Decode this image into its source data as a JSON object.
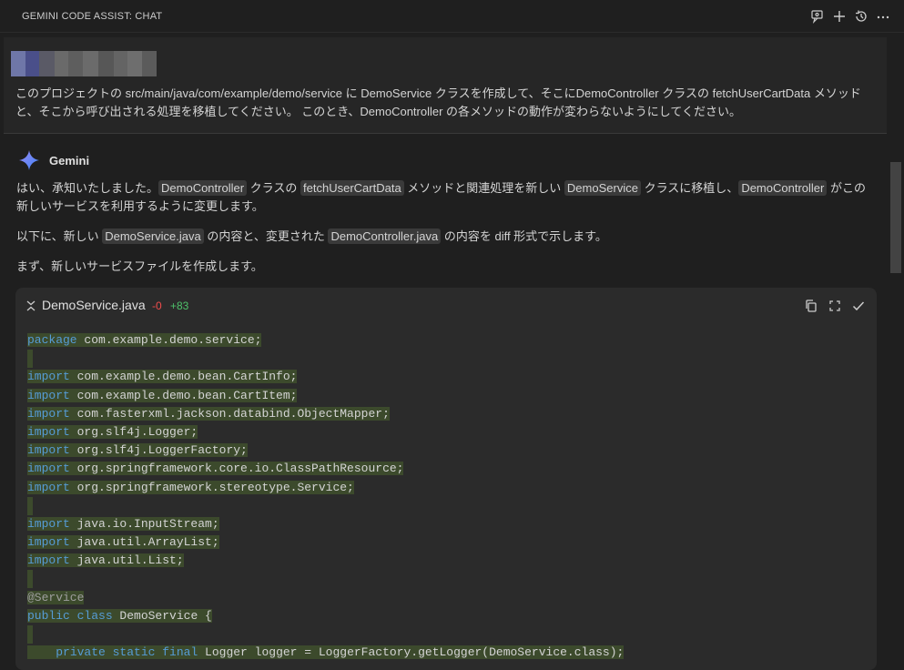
{
  "header": {
    "title": "GEMINI CODE ASSIST: CHAT"
  },
  "user_message": {
    "text": "このプロジェクトの src/main/java/com/example/demo/service に DemoService クラスを作成して、そこにDemoController クラスの fetchUserCartData メソッドと、そこから呼び出される処理を移植してください。 このとき、DemoController の各メソッドの動作が変わらないようにしてください。"
  },
  "gemini": {
    "name": "Gemini",
    "p1": {
      "t1": "はい、承知いたしました。",
      "c1": "DemoController",
      "t2": " クラスの ",
      "c2": "fetchUserCartData",
      "t3": " メソッドと関連処理を新しい ",
      "c3": "DemoService",
      "t4": " クラスに移植し、",
      "c4": "DemoController",
      "t5": " がこの新しいサービスを利用するように変更します。"
    },
    "p2": {
      "t1": "以下に、新しい ",
      "c1": "DemoService.java",
      "t2": " の内容と、変更された ",
      "c2": "DemoController.java",
      "t3": " の内容を diff 形式で示します。"
    },
    "p3": "まず、新しいサービスファイルを作成します。"
  },
  "code_card": {
    "filename": "DemoService.java",
    "deletions": "-0",
    "additions": "+83",
    "lines": [
      {
        "kw": "package",
        "rest": " com.example.demo.service;"
      },
      {
        "kw": "",
        "rest": ""
      },
      {
        "kw": "import",
        "rest": " com.example.demo.bean.CartInfo;"
      },
      {
        "kw": "import",
        "rest": " com.example.demo.bean.CartItem;"
      },
      {
        "kw": "import",
        "rest": " com.fasterxml.jackson.databind.ObjectMapper;"
      },
      {
        "kw": "import",
        "rest": " org.slf4j.Logger;"
      },
      {
        "kw": "import",
        "rest": " org.slf4j.LoggerFactory;"
      },
      {
        "kw": "import",
        "rest": " org.springframework.core.io.ClassPathResource;"
      },
      {
        "kw": "import",
        "rest": " org.springframework.stereotype.Service;"
      },
      {
        "kw": "",
        "rest": ""
      },
      {
        "kw": "import",
        "rest": " java.io.InputStream;"
      },
      {
        "kw": "import",
        "rest": " java.util.ArrayList;"
      },
      {
        "kw": "import",
        "rest": " java.util.List;"
      },
      {
        "kw": "",
        "rest": ""
      },
      {
        "ann": "@Service"
      },
      {
        "kw": "public class",
        "rest": " DemoService {"
      },
      {
        "kw": "",
        "rest": ""
      },
      {
        "indent": "    ",
        "kw": "private static final",
        "rest": " Logger logger = LoggerFactory.getLogger(DemoService.class);"
      }
    ]
  }
}
